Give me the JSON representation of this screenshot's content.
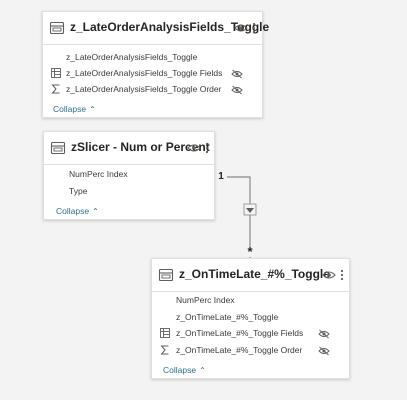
{
  "tables": [
    {
      "title": "z_LateOrderAnalysisFields_Toggle",
      "rows": [
        {
          "label": "z_LateOrderAnalysisFields_Toggle",
          "icon": "none",
          "hidden": false
        },
        {
          "label": "z_LateOrderAnalysisFields_Toggle Fields",
          "icon": "table-column-icon",
          "hidden": true
        },
        {
          "label": "z_LateOrderAnalysisFields_Toggle Order",
          "icon": "sigma-icon",
          "hidden": true
        }
      ],
      "collapse_label": "Collapse"
    },
    {
      "title": "zSlicer - Num or Percent",
      "rows": [
        {
          "label": "NumPerc Index",
          "icon": "none",
          "hidden": false
        },
        {
          "label": "Type",
          "icon": "none",
          "hidden": false
        }
      ],
      "collapse_label": "Collapse"
    },
    {
      "title": "z_OnTimeLate_#%_Toggle",
      "rows": [
        {
          "label": "NumPerc Index",
          "icon": "none",
          "hidden": false
        },
        {
          "label": "z_OnTimeLate_#%_Toggle",
          "icon": "none",
          "hidden": false
        },
        {
          "label": "z_OnTimeLate_#%_Toggle Fields",
          "icon": "table-column-icon",
          "hidden": true
        },
        {
          "label": "z_OnTimeLate_#%_Toggle Order",
          "icon": "sigma-icon",
          "hidden": true
        }
      ],
      "collapse_label": "Collapse"
    }
  ],
  "relationship": {
    "from_cardinality": "1",
    "to_cardinality": "*",
    "filter_direction": "single"
  },
  "colors": {
    "background": "#f3f3f3",
    "card": "#ffffff",
    "border": "#e1dfdd",
    "link": "#2b6f8a",
    "line": "#8a8886"
  }
}
